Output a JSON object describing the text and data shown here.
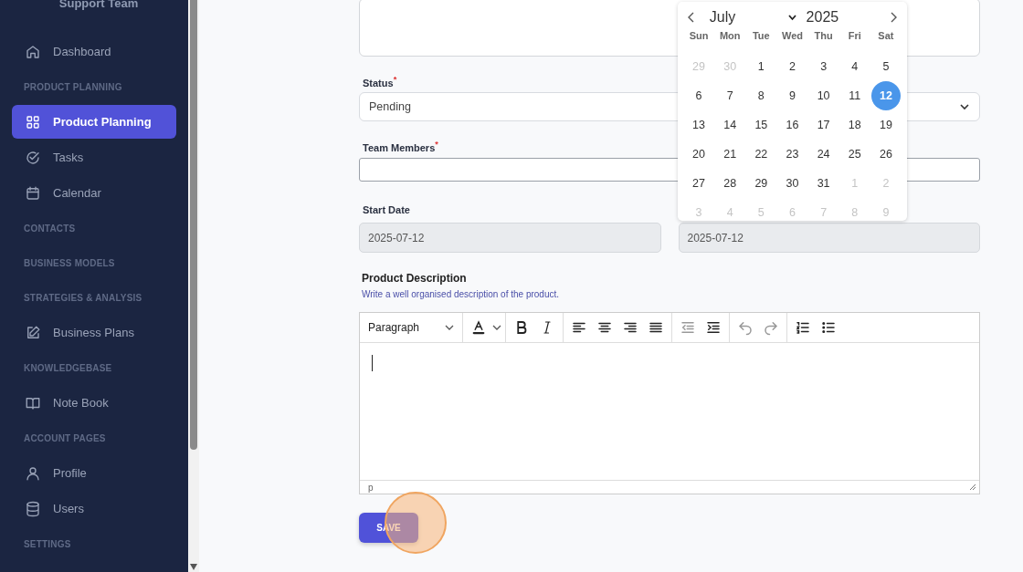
{
  "sidebar": {
    "title": "Support Team",
    "items": [
      {
        "kind": "link",
        "label": "Dashboard",
        "selected": false
      },
      {
        "kind": "header",
        "label": "PRODUCT PLANNING"
      },
      {
        "kind": "link",
        "label": "Product Planning",
        "selected": true
      },
      {
        "kind": "link",
        "label": "Tasks",
        "selected": false
      },
      {
        "kind": "link",
        "label": "Calendar",
        "selected": false
      },
      {
        "kind": "header",
        "label": "CONTACTS"
      },
      {
        "kind": "header",
        "label": "BUSINESS MODELS"
      },
      {
        "kind": "header",
        "label": "STRATEGIES & ANALYSIS"
      },
      {
        "kind": "link",
        "label": "Business Plans",
        "selected": false
      },
      {
        "kind": "header",
        "label": "KNOWLEDGEBASE"
      },
      {
        "kind": "link",
        "label": "Note Book",
        "selected": false
      },
      {
        "kind": "header",
        "label": "ACCOUNT PAGES"
      },
      {
        "kind": "link",
        "label": "Profile",
        "selected": false
      },
      {
        "kind": "link",
        "label": "Users",
        "selected": false
      },
      {
        "kind": "header",
        "label": "SETTINGS"
      }
    ]
  },
  "form": {
    "status": {
      "label": "Status",
      "required_mark": "*",
      "value": "Pending"
    },
    "team_members": {
      "label": "Team Members",
      "required_mark": "*"
    },
    "start_date": {
      "label": "Start Date",
      "value": "2025-07-12"
    },
    "end_date": {
      "value": "2025-07-12"
    },
    "description": {
      "label": "Product Description",
      "help": "Write a well organised description of the product.",
      "block_format": "Paragraph",
      "path": "p"
    },
    "save_button": "SAVE"
  },
  "calendar": {
    "month": "July",
    "year": "2025",
    "weekdays": [
      "Sun",
      "Mon",
      "Tue",
      "Wed",
      "Thu",
      "Fri",
      "Sat"
    ],
    "days": [
      {
        "day": "29",
        "outside": true,
        "selected": false
      },
      {
        "day": "30",
        "outside": true,
        "selected": false
      },
      {
        "day": "1",
        "outside": false,
        "selected": false
      },
      {
        "day": "2",
        "outside": false,
        "selected": false
      },
      {
        "day": "3",
        "outside": false,
        "selected": false
      },
      {
        "day": "4",
        "outside": false,
        "selected": false
      },
      {
        "day": "5",
        "outside": false,
        "selected": false
      },
      {
        "day": "6",
        "outside": false,
        "selected": false
      },
      {
        "day": "7",
        "outside": false,
        "selected": false
      },
      {
        "day": "8",
        "outside": false,
        "selected": false
      },
      {
        "day": "9",
        "outside": false,
        "selected": false
      },
      {
        "day": "10",
        "outside": false,
        "selected": false
      },
      {
        "day": "11",
        "outside": false,
        "selected": false
      },
      {
        "day": "12",
        "outside": false,
        "selected": true
      },
      {
        "day": "13",
        "outside": false,
        "selected": false
      },
      {
        "day": "14",
        "outside": false,
        "selected": false
      },
      {
        "day": "15",
        "outside": false,
        "selected": false
      },
      {
        "day": "16",
        "outside": false,
        "selected": false
      },
      {
        "day": "17",
        "outside": false,
        "selected": false
      },
      {
        "day": "18",
        "outside": false,
        "selected": false
      },
      {
        "day": "19",
        "outside": false,
        "selected": false
      },
      {
        "day": "20",
        "outside": false,
        "selected": false
      },
      {
        "day": "21",
        "outside": false,
        "selected": false
      },
      {
        "day": "22",
        "outside": false,
        "selected": false
      },
      {
        "day": "23",
        "outside": false,
        "selected": false
      },
      {
        "day": "24",
        "outside": false,
        "selected": false
      },
      {
        "day": "25",
        "outside": false,
        "selected": false
      },
      {
        "day": "26",
        "outside": false,
        "selected": false
      },
      {
        "day": "27",
        "outside": false,
        "selected": false
      },
      {
        "day": "28",
        "outside": false,
        "selected": false
      },
      {
        "day": "29",
        "outside": false,
        "selected": false
      },
      {
        "day": "30",
        "outside": false,
        "selected": false
      },
      {
        "day": "31",
        "outside": false,
        "selected": false
      },
      {
        "day": "1",
        "outside": true,
        "selected": false
      },
      {
        "day": "2",
        "outside": true,
        "selected": false
      },
      {
        "day": "3",
        "outside": true,
        "selected": false
      },
      {
        "day": "4",
        "outside": true,
        "selected": false
      },
      {
        "day": "5",
        "outside": true,
        "selected": false
      },
      {
        "day": "6",
        "outside": true,
        "selected": false
      },
      {
        "day": "7",
        "outside": true,
        "selected": false
      },
      {
        "day": "8",
        "outside": true,
        "selected": false
      },
      {
        "day": "9",
        "outside": true,
        "selected": false
      }
    ]
  }
}
